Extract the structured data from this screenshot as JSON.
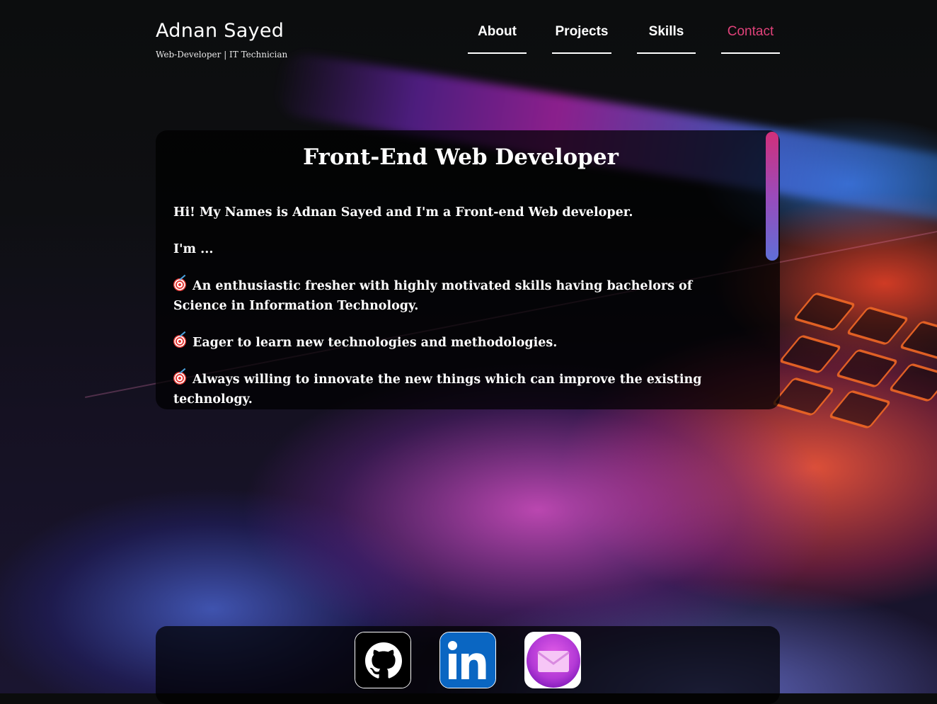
{
  "header": {
    "name": "Adnan Sayed",
    "tagline": "Web-Developer | IT Technician"
  },
  "nav": {
    "items": [
      {
        "label": "About"
      },
      {
        "label": "Projects"
      },
      {
        "label": "Skills"
      },
      {
        "label": "Contact",
        "active": true
      }
    ],
    "active_color": "#e0427a"
  },
  "panel": {
    "title": "Front-End Web Developer",
    "intro": "Hi! My Names is Adnan Sayed and I'm a Front-end Web developer.",
    "im": "I'm ...",
    "bullets": [
      "An enthusiastic fresher with highly motivated skills having bachelors of Science in Information Technology.",
      "Eager to learn new technologies and methodologies.",
      "Always willing to innovate the new things which can improve the existing technology."
    ],
    "bullet_icon": "direct-hit-target-icon"
  },
  "social": [
    {
      "name": "GitHub",
      "icon": "github-icon"
    },
    {
      "name": "LinkedIn",
      "icon": "linkedin-icon"
    },
    {
      "name": "Email",
      "icon": "mail-icon"
    }
  ],
  "colors": {
    "scroll_gradient": [
      "#d12f7a",
      "#9a4bbb",
      "#5f6fd6"
    ],
    "linkedin_blue": "#0a66c2",
    "mail_purple": "#b43ad6"
  }
}
